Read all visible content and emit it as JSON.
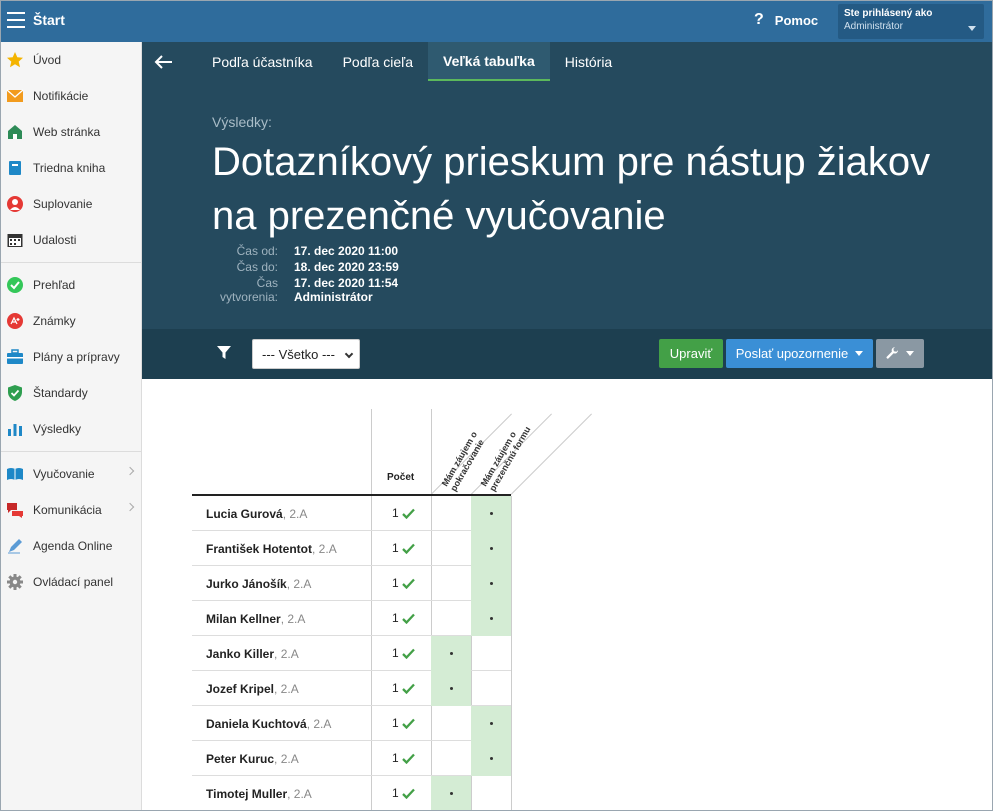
{
  "topbar": {
    "title": "Štart",
    "help": "Pomoc",
    "user_line1": "Ste prihlásený ako",
    "user_line2": "Administrátor"
  },
  "sidebar": {
    "group1": [
      {
        "label": "Úvod",
        "icon": "star-icon"
      },
      {
        "label": "Notifikácie",
        "icon": "envelope-icon"
      },
      {
        "label": "Web stránka",
        "icon": "home-icon"
      },
      {
        "label": "Triedna kniha",
        "icon": "book-icon"
      },
      {
        "label": "Suplovanie",
        "icon": "person-icon"
      },
      {
        "label": "Udalosti",
        "icon": "calendar-icon"
      }
    ],
    "group2": [
      {
        "label": "Prehľad",
        "icon": "check-circle-icon"
      },
      {
        "label": "Známky",
        "icon": "grade-icon"
      },
      {
        "label": "Plány a prípravy",
        "icon": "briefcase-icon"
      },
      {
        "label": "Štandardy",
        "icon": "shield-icon"
      },
      {
        "label": "Výsledky",
        "icon": "bar-chart-icon"
      }
    ],
    "group3": [
      {
        "label": "Vyučovanie",
        "icon": "open-book-icon"
      },
      {
        "label": "Komunikácia",
        "icon": "chat-icon"
      },
      {
        "label": "Agenda Online",
        "icon": "pen-icon"
      },
      {
        "label": "Ovládací panel",
        "icon": "gear-icon"
      }
    ]
  },
  "tabs": [
    {
      "label": "Podľa účastníka",
      "active": false
    },
    {
      "label": "Podľa cieľa",
      "active": false
    },
    {
      "label": "Veľká tabuľka",
      "active": true
    },
    {
      "label": "História",
      "active": false
    }
  ],
  "header": {
    "results_label": "Výsledky:",
    "title": "Dotazníkový prieskum pre nástup žiakov na prezenčné vyučovanie",
    "time_from_label": "Čas od:",
    "time_from": "17. dec 2020 11:00",
    "time_to_label": "Čas do:",
    "time_to": "18. dec 2020 23:59",
    "created_label_1": "Čas",
    "created_label_2": "vytvorenia:",
    "created": "17. dec 2020 11:54",
    "created_by": "Administrátor"
  },
  "toolbar": {
    "filter_value": "--- Všetko ---",
    "edit": "Upraviť",
    "notify": "Poslať upozornenie"
  },
  "table": {
    "count_header": "Počet",
    "option1_line1": "Mám záujem o",
    "option1_line2": "pokračovanie",
    "option2_line1": "Mám záujem o",
    "option2_line2": "prezenčnú formu",
    "rows": [
      {
        "name": "Lucia Gurová",
        "cls": ", 2.A",
        "count": "1",
        "choice": 2
      },
      {
        "name": "František Hotentot",
        "cls": ", 2.A",
        "count": "1",
        "choice": 2
      },
      {
        "name": "Jurko Jánošík",
        "cls": ", 2.A",
        "count": "1",
        "choice": 2
      },
      {
        "name": "Milan Kellner",
        "cls": ", 2.A",
        "count": "1",
        "choice": 2
      },
      {
        "name": "Janko Killer",
        "cls": ", 2.A",
        "count": "1",
        "choice": 1
      },
      {
        "name": "Jozef Kripel",
        "cls": ", 2.A",
        "count": "1",
        "choice": 1
      },
      {
        "name": "Daniela Kuchtová",
        "cls": ", 2.A",
        "count": "1",
        "choice": 2
      },
      {
        "name": "Peter Kuruc",
        "cls": ", 2.A",
        "count": "1",
        "choice": 2
      },
      {
        "name": "Timotej Muller",
        "cls": ", 2.A",
        "count": "1",
        "choice": 1
      }
    ]
  },
  "colors": {
    "topbar": "#2f6c9c",
    "header": "#254a5e",
    "toolbar": "#1d3f50",
    "green": "#43a047",
    "blue": "#3a8fd6",
    "cell_on": "#d4ecd4"
  }
}
